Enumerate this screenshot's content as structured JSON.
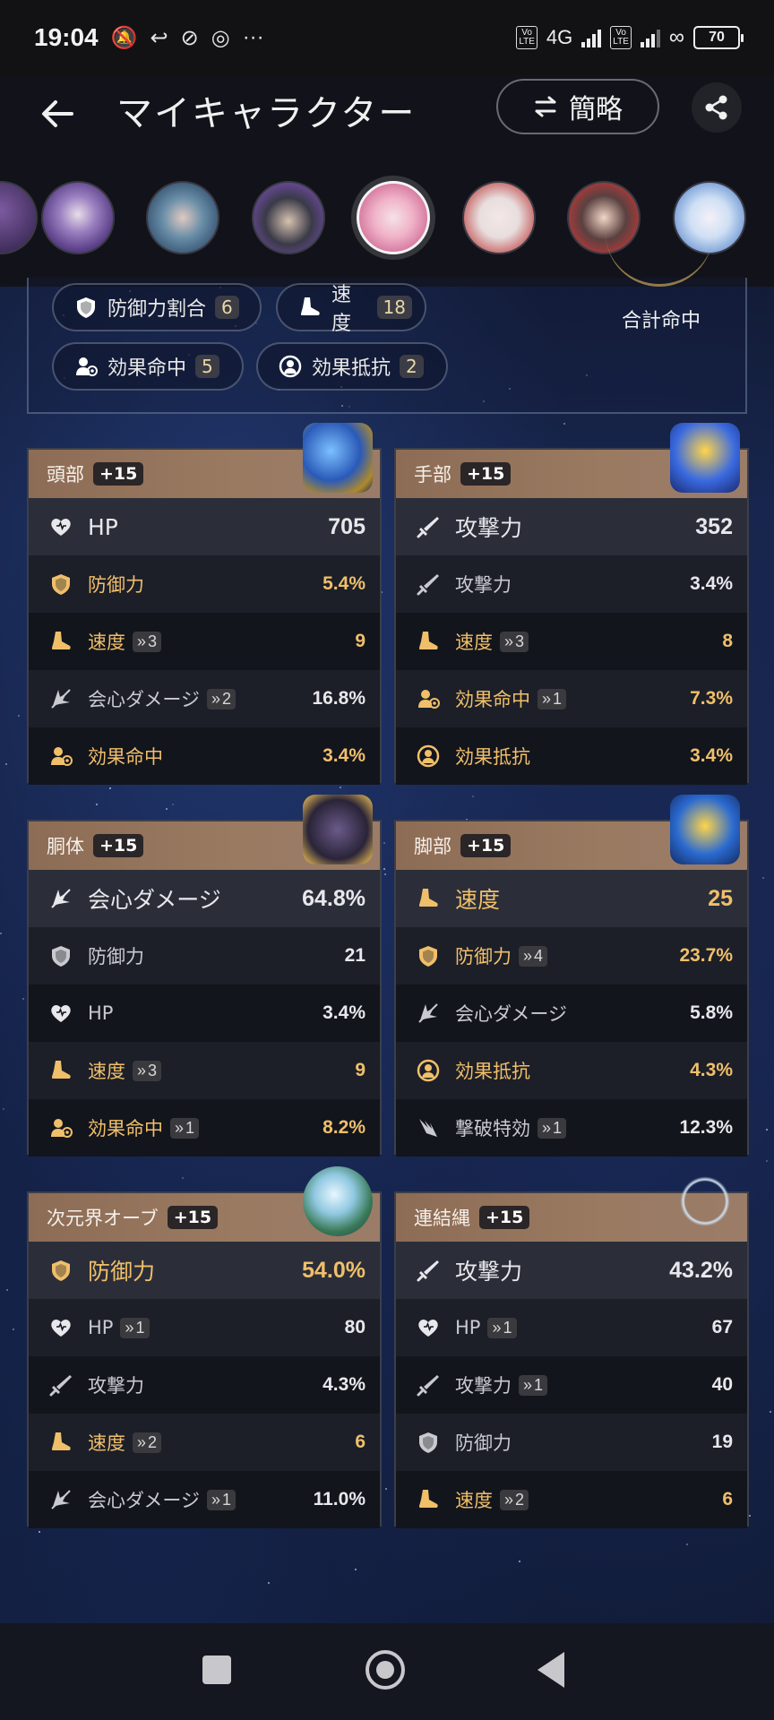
{
  "status_bar": {
    "time": "19:04",
    "network": "4G",
    "battery": "70"
  },
  "header": {
    "title": "マイキャラクター",
    "toggle_label": "簡略"
  },
  "summary": {
    "pills": [
      {
        "label": "防御力割合",
        "count": "6",
        "icon": "shield-icon"
      },
      {
        "label": "速度",
        "count": "18",
        "icon": "boot-icon"
      },
      {
        "label": "効果命中",
        "count": "5",
        "icon": "effect-hit-icon"
      },
      {
        "label": "効果抵抗",
        "count": "2",
        "icon": "effect-res-icon"
      }
    ],
    "total_label": "合計命中"
  },
  "relics": [
    {
      "slot": "頭部",
      "level": "+15",
      "relic_icon": "helmet-icon",
      "main": {
        "name": "HP",
        "value": "705",
        "icon": "heart-icon"
      },
      "subs": [
        {
          "name": "防御力",
          "value": "5.4%",
          "rolls": "",
          "highlight": true,
          "icon": "shield-icon"
        },
        {
          "name": "速度",
          "value": "9",
          "rolls": "3",
          "highlight": true,
          "icon": "boot-icon"
        },
        {
          "name": "会心ダメージ",
          "value": "16.8%",
          "rolls": "2",
          "highlight": false,
          "icon": "crit-dmg-icon"
        },
        {
          "name": "効果命中",
          "value": "3.4%",
          "rolls": "",
          "highlight": true,
          "icon": "effect-hit-icon"
        }
      ]
    },
    {
      "slot": "手部",
      "level": "+15",
      "relic_icon": "gauntlet-icon",
      "main": {
        "name": "攻撃力",
        "value": "352",
        "icon": "sword-icon"
      },
      "subs": [
        {
          "name": "攻撃力",
          "value": "3.4%",
          "rolls": "",
          "highlight": false,
          "icon": "sword-icon"
        },
        {
          "name": "速度",
          "value": "8",
          "rolls": "3",
          "highlight": true,
          "icon": "boot-icon"
        },
        {
          "name": "効果命中",
          "value": "7.3%",
          "rolls": "1",
          "highlight": true,
          "icon": "effect-hit-icon"
        },
        {
          "name": "効果抵抗",
          "value": "3.4%",
          "rolls": "",
          "highlight": true,
          "icon": "effect-res-icon"
        }
      ]
    },
    {
      "slot": "胴体",
      "level": "+15",
      "relic_icon": "armor-icon",
      "main": {
        "name": "会心ダメージ",
        "value": "64.8%",
        "icon": "crit-dmg-icon"
      },
      "subs": [
        {
          "name": "防御力",
          "value": "21",
          "rolls": "",
          "highlight": false,
          "icon": "shield-icon"
        },
        {
          "name": "HP",
          "value": "3.4%",
          "rolls": "",
          "highlight": false,
          "icon": "heart-icon"
        },
        {
          "name": "速度",
          "value": "9",
          "rolls": "3",
          "highlight": true,
          "icon": "boot-icon"
        },
        {
          "name": "効果命中",
          "value": "8.2%",
          "rolls": "1",
          "highlight": true,
          "icon": "effect-hit-icon"
        }
      ]
    },
    {
      "slot": "脚部",
      "level": "+15",
      "relic_icon": "boots-icon",
      "main": {
        "name": "速度",
        "value": "25",
        "icon": "boot-icon",
        "highlight": true
      },
      "subs": [
        {
          "name": "防御力",
          "value": "23.7%",
          "rolls": "4",
          "highlight": true,
          "icon": "shield-icon"
        },
        {
          "name": "会心ダメージ",
          "value": "5.8%",
          "rolls": "",
          "highlight": false,
          "icon": "crit-dmg-icon"
        },
        {
          "name": "効果抵抗",
          "value": "4.3%",
          "rolls": "",
          "highlight": true,
          "icon": "effect-res-icon"
        },
        {
          "name": "撃破特効",
          "value": "12.3%",
          "rolls": "1",
          "highlight": false,
          "icon": "break-icon"
        }
      ]
    },
    {
      "slot": "次元界オーブ",
      "level": "+15",
      "relic_icon": "orb-icon",
      "main": {
        "name": "防御力",
        "value": "54.0%",
        "icon": "shield-icon",
        "highlight": true
      },
      "subs": [
        {
          "name": "HP",
          "value": "80",
          "rolls": "1",
          "highlight": false,
          "icon": "heart-icon"
        },
        {
          "name": "攻撃力",
          "value": "4.3%",
          "rolls": "",
          "highlight": false,
          "icon": "sword-icon"
        },
        {
          "name": "速度",
          "value": "6",
          "rolls": "2",
          "highlight": true,
          "icon": "boot-icon"
        },
        {
          "name": "会心ダメージ",
          "value": "11.0%",
          "rolls": "1",
          "highlight": false,
          "icon": "crit-dmg-icon"
        }
      ]
    },
    {
      "slot": "連結縄",
      "level": "+15",
      "relic_icon": "rope-icon",
      "main": {
        "name": "攻撃力",
        "value": "43.2%",
        "icon": "sword-icon"
      },
      "subs": [
        {
          "name": "HP",
          "value": "67",
          "rolls": "1",
          "highlight": false,
          "icon": "heart-icon"
        },
        {
          "name": "攻撃力",
          "value": "40",
          "rolls": "1",
          "highlight": false,
          "icon": "sword-icon"
        },
        {
          "name": "防御力",
          "value": "19",
          "rolls": "",
          "highlight": false,
          "icon": "shield-icon"
        },
        {
          "name": "速度",
          "value": "6",
          "rolls": "2",
          "highlight": true,
          "icon": "boot-icon"
        }
      ]
    }
  ],
  "colors": {
    "highlight": "#f0bf6a",
    "card_header": "#9b7a62",
    "background": "#142042"
  }
}
